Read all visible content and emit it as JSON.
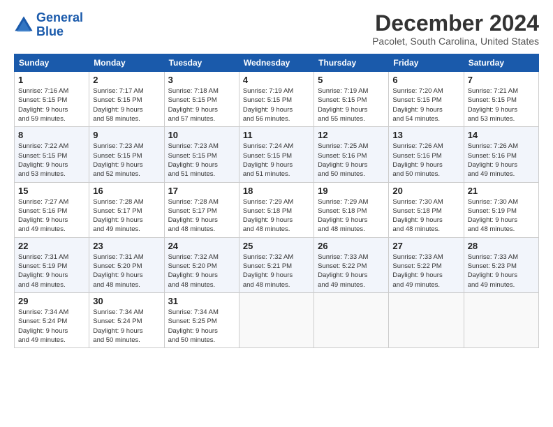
{
  "header": {
    "logo_line1": "General",
    "logo_line2": "Blue",
    "month_title": "December 2024",
    "subtitle": "Pacolet, South Carolina, United States"
  },
  "days_of_week": [
    "Sunday",
    "Monday",
    "Tuesday",
    "Wednesday",
    "Thursday",
    "Friday",
    "Saturday"
  ],
  "weeks": [
    [
      {
        "day": "1",
        "info": "Sunrise: 7:16 AM\nSunset: 5:15 PM\nDaylight: 9 hours\nand 59 minutes."
      },
      {
        "day": "2",
        "info": "Sunrise: 7:17 AM\nSunset: 5:15 PM\nDaylight: 9 hours\nand 58 minutes."
      },
      {
        "day": "3",
        "info": "Sunrise: 7:18 AM\nSunset: 5:15 PM\nDaylight: 9 hours\nand 57 minutes."
      },
      {
        "day": "4",
        "info": "Sunrise: 7:19 AM\nSunset: 5:15 PM\nDaylight: 9 hours\nand 56 minutes."
      },
      {
        "day": "5",
        "info": "Sunrise: 7:19 AM\nSunset: 5:15 PM\nDaylight: 9 hours\nand 55 minutes."
      },
      {
        "day": "6",
        "info": "Sunrise: 7:20 AM\nSunset: 5:15 PM\nDaylight: 9 hours\nand 54 minutes."
      },
      {
        "day": "7",
        "info": "Sunrise: 7:21 AM\nSunset: 5:15 PM\nDaylight: 9 hours\nand 53 minutes."
      }
    ],
    [
      {
        "day": "8",
        "info": "Sunrise: 7:22 AM\nSunset: 5:15 PM\nDaylight: 9 hours\nand 53 minutes."
      },
      {
        "day": "9",
        "info": "Sunrise: 7:23 AM\nSunset: 5:15 PM\nDaylight: 9 hours\nand 52 minutes."
      },
      {
        "day": "10",
        "info": "Sunrise: 7:23 AM\nSunset: 5:15 PM\nDaylight: 9 hours\nand 51 minutes."
      },
      {
        "day": "11",
        "info": "Sunrise: 7:24 AM\nSunset: 5:15 PM\nDaylight: 9 hours\nand 51 minutes."
      },
      {
        "day": "12",
        "info": "Sunrise: 7:25 AM\nSunset: 5:16 PM\nDaylight: 9 hours\nand 50 minutes."
      },
      {
        "day": "13",
        "info": "Sunrise: 7:26 AM\nSunset: 5:16 PM\nDaylight: 9 hours\nand 50 minutes."
      },
      {
        "day": "14",
        "info": "Sunrise: 7:26 AM\nSunset: 5:16 PM\nDaylight: 9 hours\nand 49 minutes."
      }
    ],
    [
      {
        "day": "15",
        "info": "Sunrise: 7:27 AM\nSunset: 5:16 PM\nDaylight: 9 hours\nand 49 minutes."
      },
      {
        "day": "16",
        "info": "Sunrise: 7:28 AM\nSunset: 5:17 PM\nDaylight: 9 hours\nand 49 minutes."
      },
      {
        "day": "17",
        "info": "Sunrise: 7:28 AM\nSunset: 5:17 PM\nDaylight: 9 hours\nand 48 minutes."
      },
      {
        "day": "18",
        "info": "Sunrise: 7:29 AM\nSunset: 5:18 PM\nDaylight: 9 hours\nand 48 minutes."
      },
      {
        "day": "19",
        "info": "Sunrise: 7:29 AM\nSunset: 5:18 PM\nDaylight: 9 hours\nand 48 minutes."
      },
      {
        "day": "20",
        "info": "Sunrise: 7:30 AM\nSunset: 5:18 PM\nDaylight: 9 hours\nand 48 minutes."
      },
      {
        "day": "21",
        "info": "Sunrise: 7:30 AM\nSunset: 5:19 PM\nDaylight: 9 hours\nand 48 minutes."
      }
    ],
    [
      {
        "day": "22",
        "info": "Sunrise: 7:31 AM\nSunset: 5:19 PM\nDaylight: 9 hours\nand 48 minutes."
      },
      {
        "day": "23",
        "info": "Sunrise: 7:31 AM\nSunset: 5:20 PM\nDaylight: 9 hours\nand 48 minutes."
      },
      {
        "day": "24",
        "info": "Sunrise: 7:32 AM\nSunset: 5:20 PM\nDaylight: 9 hours\nand 48 minutes."
      },
      {
        "day": "25",
        "info": "Sunrise: 7:32 AM\nSunset: 5:21 PM\nDaylight: 9 hours\nand 48 minutes."
      },
      {
        "day": "26",
        "info": "Sunrise: 7:33 AM\nSunset: 5:22 PM\nDaylight: 9 hours\nand 49 minutes."
      },
      {
        "day": "27",
        "info": "Sunrise: 7:33 AM\nSunset: 5:22 PM\nDaylight: 9 hours\nand 49 minutes."
      },
      {
        "day": "28",
        "info": "Sunrise: 7:33 AM\nSunset: 5:23 PM\nDaylight: 9 hours\nand 49 minutes."
      }
    ],
    [
      {
        "day": "29",
        "info": "Sunrise: 7:34 AM\nSunset: 5:24 PM\nDaylight: 9 hours\nand 49 minutes."
      },
      {
        "day": "30",
        "info": "Sunrise: 7:34 AM\nSunset: 5:24 PM\nDaylight: 9 hours\nand 50 minutes."
      },
      {
        "day": "31",
        "info": "Sunrise: 7:34 AM\nSunset: 5:25 PM\nDaylight: 9 hours\nand 50 minutes."
      },
      null,
      null,
      null,
      null
    ]
  ]
}
